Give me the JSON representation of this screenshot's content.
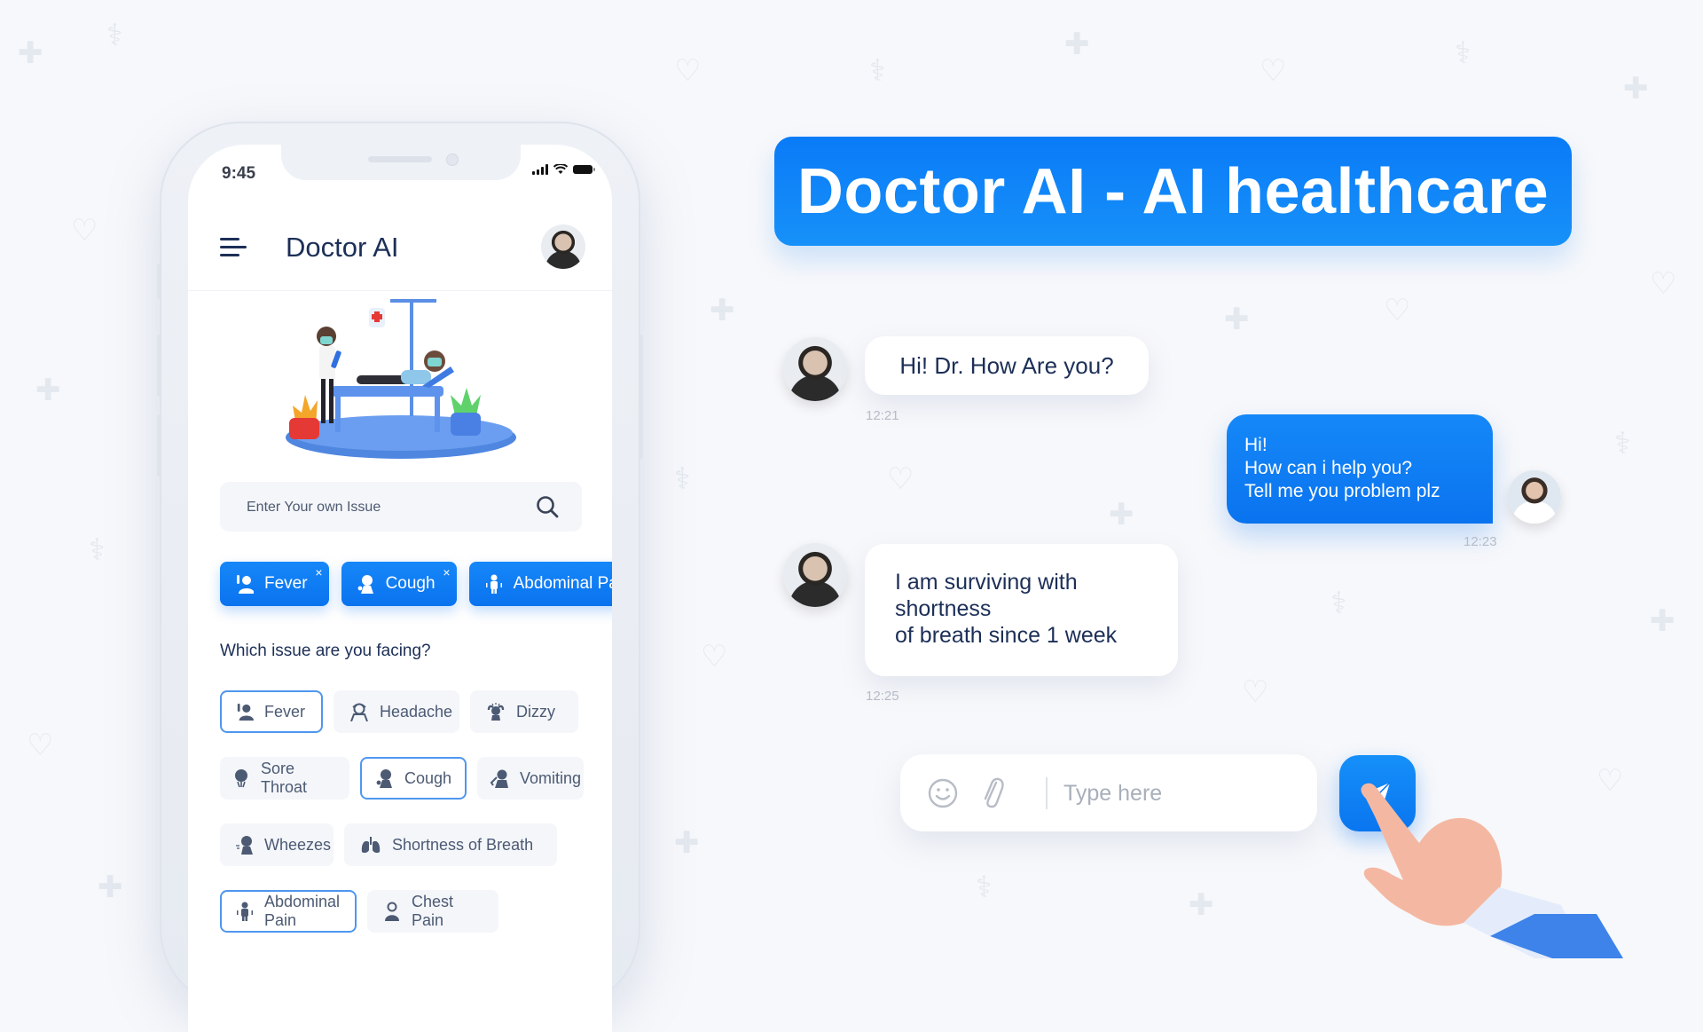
{
  "phone": {
    "status_bar": {
      "time": "9:45"
    },
    "app_header": {
      "title": "Doctor AI"
    },
    "search": {
      "placeholder": "Enter Your own Issue"
    },
    "selected_issues": [
      {
        "label": "Fever",
        "icon": "fever-icon",
        "removable": true
      },
      {
        "label": "Cough",
        "icon": "cough-icon",
        "removable": true
      },
      {
        "label": "Abdominal Pain",
        "icon": "abdominal-pain-icon",
        "removable": false
      }
    ],
    "remove_glyph": "×",
    "question": "Which issue are you facing?",
    "options": [
      [
        {
          "label": "Fever",
          "icon": "fever-icon",
          "selected": true
        },
        {
          "label": "Headache",
          "icon": "headache-icon",
          "selected": false
        },
        {
          "label": "Dizzy",
          "icon": "dizzy-icon",
          "selected": false
        }
      ],
      [
        {
          "label": "Sore Throat",
          "icon": "sore-throat-icon",
          "selected": false
        },
        {
          "label": "Cough",
          "icon": "cough-icon",
          "selected": true
        },
        {
          "label": "Vomiting",
          "icon": "vomiting-icon",
          "selected": false
        }
      ],
      [
        {
          "label": "Wheezes",
          "icon": "wheezes-icon",
          "selected": false
        },
        {
          "label": "Shortness of Breath",
          "icon": "lungs-icon",
          "selected": false
        }
      ],
      [
        {
          "label": "Abdominal Pain",
          "icon": "abdominal-pain-icon",
          "selected": true
        },
        {
          "label": "Chest Pain",
          "icon": "chest-pain-icon",
          "selected": false
        }
      ]
    ]
  },
  "banner": {
    "title": "Doctor AI - AI healthcare"
  },
  "chat": {
    "messages": [
      {
        "sender": "user",
        "lines": [
          "Hi! Dr. How Are you?"
        ],
        "time": "12:21"
      },
      {
        "sender": "doctor",
        "lines": [
          "Hi!",
          "How can i help you?",
          "Tell me you problem plz"
        ],
        "time": "12:23"
      },
      {
        "sender": "user",
        "lines": [
          "I am surviving with",
          "shortness",
          "of breath since 1 week"
        ],
        "time": "12:25"
      }
    ],
    "input": {
      "placeholder": "Type here"
    }
  },
  "colors": {
    "accent": "#0a7bf7",
    "text_dark": "#1c2f57",
    "chip_inactive_bg": "#f4f6fa",
    "chip_text": "#4c5a73",
    "timestamp": "#b6bcc7"
  }
}
